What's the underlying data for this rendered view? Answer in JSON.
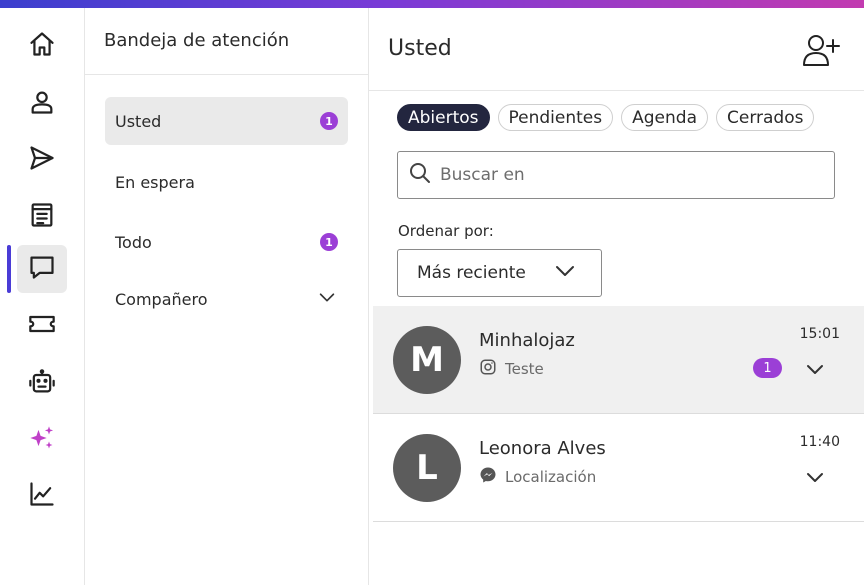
{
  "rail": {
    "items": [
      {
        "icon": "home-icon"
      },
      {
        "icon": "user-icon"
      },
      {
        "icon": "send-icon"
      },
      {
        "icon": "document-icon"
      },
      {
        "icon": "chat-icon",
        "active": true
      },
      {
        "icon": "ticket-icon"
      },
      {
        "icon": "bot-icon"
      },
      {
        "icon": "sparkles-icon"
      },
      {
        "icon": "chart-icon"
      }
    ],
    "accent": "#4a3cd6",
    "sparkle_color": "#c040c8"
  },
  "inbox": {
    "title": "Bandeja de atención",
    "items": [
      {
        "label": "Usted",
        "badge": "1"
      },
      {
        "label": "En espera"
      },
      {
        "label": "Todo",
        "badge": "1"
      },
      {
        "label": "Compañero"
      }
    ]
  },
  "panel": {
    "title": "Usted",
    "tabs": [
      {
        "label": "Abiertos"
      },
      {
        "label": "Pendientes"
      },
      {
        "label": "Agenda"
      },
      {
        "label": "Cerrados"
      }
    ],
    "search_placeholder": "Buscar en",
    "order_label": "Ordenar por:",
    "order_value": "Más reciente",
    "conversations": [
      {
        "initial": "M",
        "name": "Minhalojaz",
        "channel_icon": "instagram-icon",
        "preview": "Teste",
        "time": "15:01",
        "badge": "1"
      },
      {
        "initial": "L",
        "name": "Leonora Alves",
        "channel_icon": "messenger-icon",
        "preview": "Localización",
        "time": "11:40"
      }
    ]
  },
  "colors": {
    "badge": "#9b3fd6",
    "active_tab": "#23263f",
    "avatar": "#5c5c5c"
  }
}
